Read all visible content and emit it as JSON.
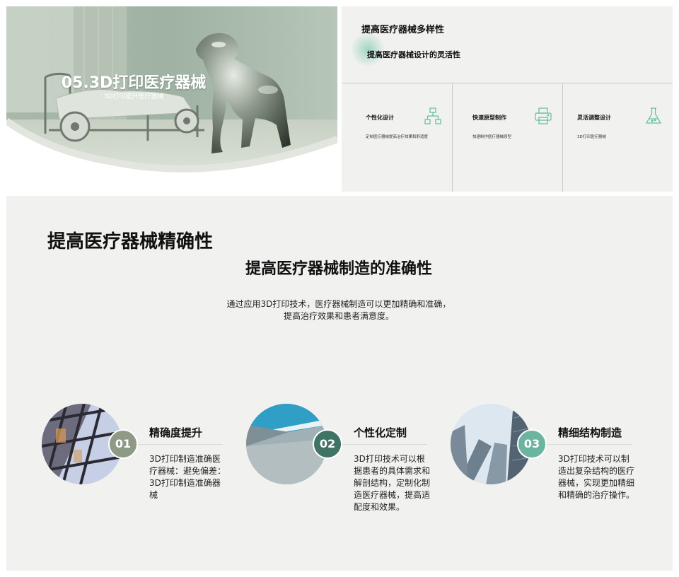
{
  "slide1": {
    "title": "05.3D打印医疗器械",
    "subtitle": "3D打印提升医疗器械"
  },
  "slide2": {
    "title": "提高医疗器械多样性",
    "subtitle": "提高医疗器械设计的灵活性",
    "accent_color": "#5fbf9f",
    "cards": [
      {
        "title": "个性化设计",
        "desc": "定制医疗器械提高治疗效果和舒适度",
        "icon": "sitemap-icon"
      },
      {
        "title": "快速原型制作",
        "desc": "快速制作医疗器械原型",
        "icon": "printer-icon"
      },
      {
        "title": "灵活调整设计",
        "desc": "3D打印医疗器械",
        "icon": "flask-icon"
      }
    ]
  },
  "slide3": {
    "title": "提高医疗器械精确性",
    "subtitle": "提高医疗器械制造的准确性",
    "description_line1": "通过应用3D打印技术，医疗器械制造可以更加精确和准确，",
    "description_line2": "提高治疗效果和患者满意度。",
    "items": [
      {
        "number": "01",
        "name": "精确度提升",
        "text": "3D打印制造准确医疗器械：避免偏差：3D打印制造准确器械",
        "badge_color": "#8f9a86"
      },
      {
        "number": "02",
        "name": "个性化定制",
        "text": "3D打印技术可以根据患者的具体需求和解剖结构，定制化制造医疗器械，提高适配度和效果。",
        "badge_color": "#3f7364"
      },
      {
        "number": "03",
        "name": "精细结构制造",
        "text": "3D打印技术可以制造出复杂结构的医疗器械，实现更加精细和精确的治疗操作。",
        "badge_color": "#6bb5a0"
      }
    ]
  }
}
